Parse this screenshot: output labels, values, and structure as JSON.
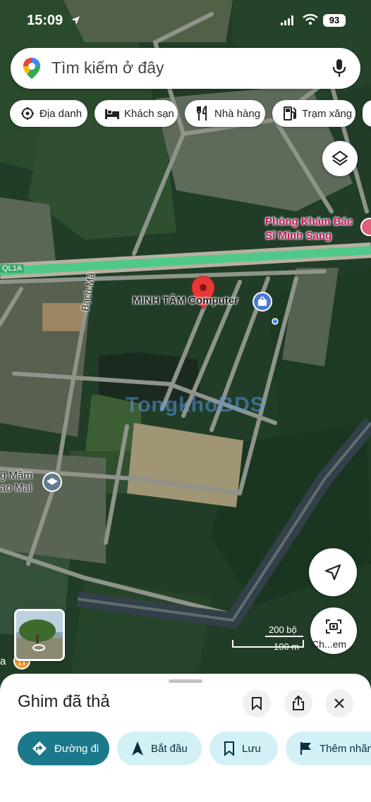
{
  "status_bar": {
    "time": "15:09",
    "battery": "93"
  },
  "search": {
    "placeholder": "Tìm kiếm ở đây"
  },
  "chips": [
    {
      "label": "Địa danh",
      "icon": "landmark-icon"
    },
    {
      "label": "Khách sạn",
      "icon": "bed-icon"
    },
    {
      "label": "Nhà hàng",
      "icon": "restaurant-icon"
    },
    {
      "label": "Trạm xăng",
      "icon": "gas-station-icon"
    }
  ],
  "map": {
    "place_labels": {
      "clinic": "Phòng Khám Bác\nSĩ Minh Sang",
      "computer_store": "MINH TÂM Computer",
      "school": "g Mầm\nao Mai",
      "street": "Bạch Mã",
      "highway": "QL1A"
    },
    "watermark": "TongkhoBDS",
    "scale": {
      "top": "200 bộ",
      "bottom": "100 m"
    },
    "street_view_label": "Ch...em",
    "dropped_pin_color": "#e53935",
    "left_edge_label": "a"
  },
  "bottom_sheet": {
    "title": "Ghim đã thả",
    "actions": [
      {
        "label": "Đường đi",
        "icon": "directions-icon"
      },
      {
        "label": "Bắt đầu",
        "icon": "navigation-arrow-icon"
      },
      {
        "label": "Lưu",
        "icon": "bookmark-icon"
      },
      {
        "label": "Thêm nhãn",
        "icon": "flag-icon"
      }
    ]
  },
  "colors": {
    "accent": "#1a7a8c",
    "pill_bg": "#d3f0f7",
    "highway": "#4fc98a"
  }
}
